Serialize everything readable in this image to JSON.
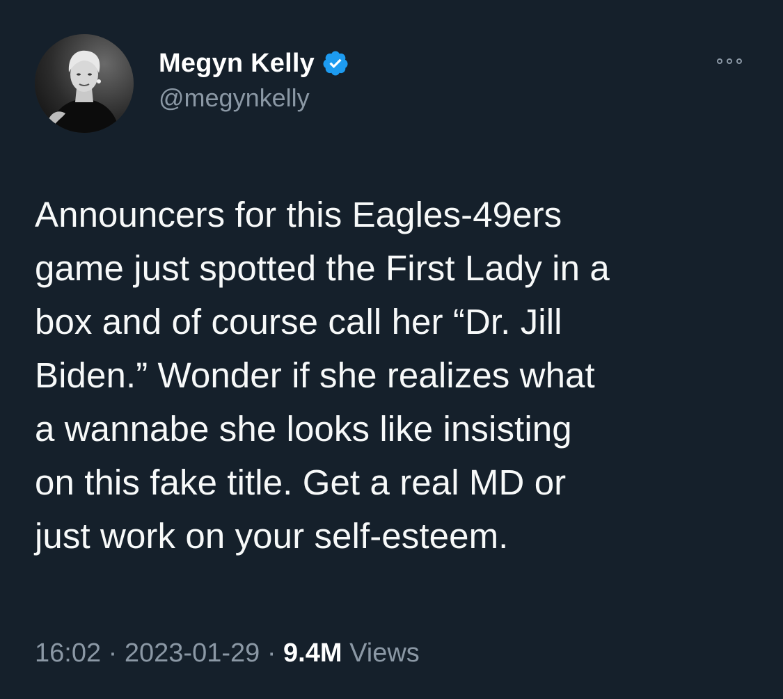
{
  "author": {
    "display_name": "Megyn Kelly",
    "handle": "@megynkelly",
    "verified": true,
    "verified_icon": "verified-badge-icon",
    "avatar_icon": "profile-photo"
  },
  "menu": {
    "more_icon": "more-options-icon"
  },
  "tweet": {
    "text": "Announcers for this Eagles-49ers\ngame just spotted the First Lady in a\nbox and of course call her “Dr. Jill\nBiden.” Wonder if she realizes what\na wannabe she looks like insisting\non this fake title. Get a real MD or\njust work on your self-esteem."
  },
  "meta": {
    "time": "16:02",
    "separator": " · ",
    "date": "2023-01-29",
    "views_count": "9.4M",
    "views_label": "Views"
  },
  "colors": {
    "background": "#15202b",
    "secondary_text": "#8b98a5",
    "verified_blue": "#1d9bf0"
  }
}
